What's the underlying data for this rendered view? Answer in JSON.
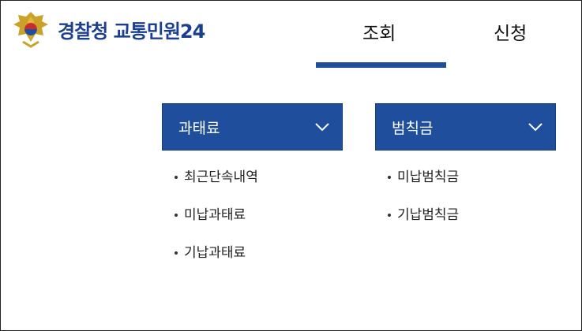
{
  "header": {
    "org_name": "경찰청",
    "service_name": "교통민원24"
  },
  "nav": {
    "tabs": [
      {
        "label": "조회",
        "active": true
      },
      {
        "label": "신청",
        "active": false
      }
    ]
  },
  "menus": {
    "fine": {
      "title": "과태료",
      "items": [
        "최근단속내역",
        "미납과태료",
        "기납과태료"
      ]
    },
    "penalty": {
      "title": "범칙금",
      "items": [
        "미납범칙금",
        "기납범칙금"
      ]
    }
  },
  "colors": {
    "brand_blue": "#1f4f9c",
    "logo_text": "#1b3f8f"
  }
}
